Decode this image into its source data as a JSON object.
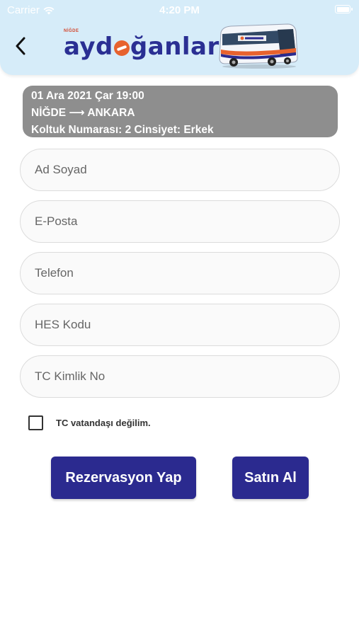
{
  "status_bar": {
    "carrier": "Carrier",
    "time": "4:20 PM",
    "battery_level": 1.0
  },
  "header": {
    "back_icon": "chevron-left-icon",
    "logo_text_pre": "ayd",
    "logo_text_post": "ğanlar",
    "logo_tag": "NİĞDE"
  },
  "trip": {
    "datetime": "01 Ara 2021 Çar 19:00",
    "route": "NİĞDE ⟶ ANKARA",
    "seat_info": "Koltuk Numarası: 2 Cinsiyet: Erkek"
  },
  "form": {
    "name_placeholder": "Ad Soyad",
    "email_placeholder": "E-Posta",
    "phone_placeholder": "Telefon",
    "hes_placeholder": "HES Kodu",
    "tc_placeholder": "TC Kimlik No",
    "not_citizen_label": "TC vatandaşı değilim.",
    "not_citizen_checked": false
  },
  "actions": {
    "reserve_label": "Rezervasyon Yap",
    "buy_label": "Satın Al"
  },
  "colors": {
    "header_bg": "#d6ecf9",
    "brand_blue": "#2b2a8f",
    "brand_orange": "#e7622e",
    "trip_bg": "#8e8e8e"
  }
}
